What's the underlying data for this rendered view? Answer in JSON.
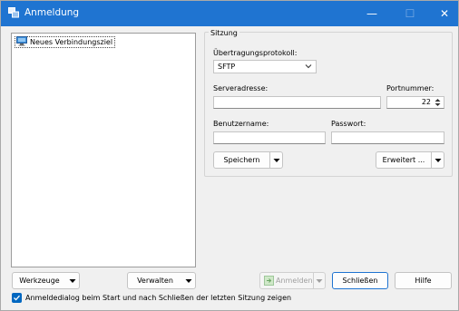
{
  "window": {
    "title": "Anmeldung",
    "accent_color": "#1f74d1",
    "controls": {
      "minimize": "—",
      "maximize": "☐",
      "close": "✕"
    }
  },
  "sites_tree": {
    "items": [
      {
        "label": "Neues Verbindungsziel",
        "icon": "computer-icon"
      }
    ]
  },
  "session": {
    "group_label": "Sitzung",
    "protocol_label": "Übertragungsprotokoll:",
    "protocol_value": "SFTP",
    "server_label": "Serveradresse:",
    "server_value": "",
    "port_label": "Portnummer:",
    "port_value": "22",
    "user_label": "Benutzername:",
    "user_value": "",
    "password_label": "Passwort:",
    "password_value": "",
    "save_button": "Speichern",
    "advanced_button": "Erweitert ..."
  },
  "bottom": {
    "tools_button": "Werkzeuge",
    "manage_button": "Verwalten",
    "login_button": "Anmelden",
    "close_button": "Schließen",
    "help_button": "Hilfe",
    "show_dialog_checkbox_label": "Anmeldedialog beim Start und nach Schließen der letzten Sitzung zeigen",
    "show_dialog_checked": true
  }
}
